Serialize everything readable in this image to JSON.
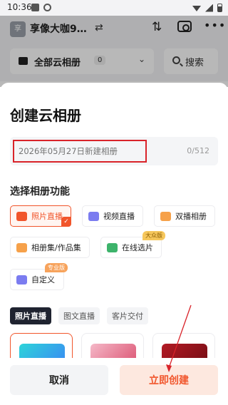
{
  "status_bar": {
    "time": "10:36"
  },
  "app_header": {
    "avatar_text": "享",
    "album_name": "享像大咖9…",
    "swap_icon": "swap-icon",
    "sort_icon": "sort-icon",
    "camera_icon": "camera-settings-icon",
    "more_icon": "more-icon"
  },
  "filter_bar": {
    "album_select_label": "全部云相册",
    "album_count": "0",
    "search_label": "搜索"
  },
  "sheet": {
    "title": "创建云相册",
    "name_input": {
      "value": "2026年05月27日新建相册",
      "counter": "0/512"
    },
    "function_section_label": "选择相册功能",
    "functions": [
      {
        "label": "照片直播",
        "selected": true,
        "icon_color": "#f1552b"
      },
      {
        "label": "视频直播",
        "selected": false,
        "icon_color": "#7b7cf0"
      },
      {
        "label": "双播相册",
        "selected": false,
        "icon_color": "#f6a14a"
      },
      {
        "label": "相册集/作品集",
        "selected": false,
        "icon_color": "#f6a14a"
      },
      {
        "label": "在线选片",
        "selected": false,
        "icon_color": "#3db36b",
        "tag": "大众版"
      },
      {
        "label": "自定义",
        "selected": false,
        "icon_color": "#7b7cf0",
        "tag": "专业版"
      }
    ],
    "mode_tabs": [
      {
        "label": "照片直播",
        "active": true
      },
      {
        "label": "图文直播",
        "active": false
      },
      {
        "label": "客片交付",
        "active": false
      }
    ],
    "templates": [
      {
        "selected": true,
        "gradient": [
          "#2dd4d9",
          "#3b82f6"
        ]
      },
      {
        "selected": false,
        "gradient": [
          "#f5b8c8",
          "#d94a6a"
        ]
      },
      {
        "selected": false,
        "gradient": [
          "#b31b25",
          "#6e0b12"
        ]
      }
    ],
    "buttons": {
      "cancel": "取消",
      "create": "立即创建"
    },
    "colors": {
      "accent": "#f1552b",
      "highlight_box": "#d9232a"
    }
  }
}
